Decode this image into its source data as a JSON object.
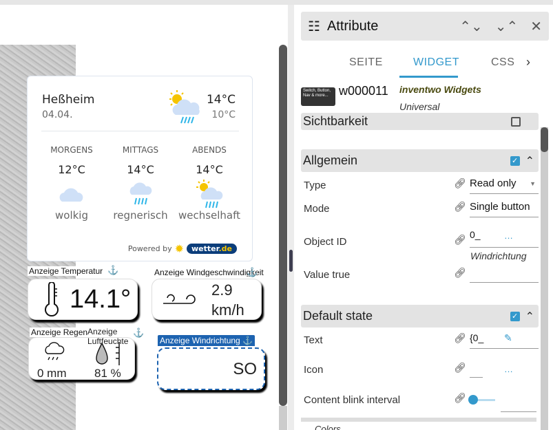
{
  "weather": {
    "city": "Heßheim",
    "date": "04.04.",
    "temp_max": "14°C",
    "temp_min": "10°C",
    "periods": [
      {
        "label": "MORGENS",
        "temp": "12°C",
        "desc": "wolkig",
        "icon": "cloud-icon"
      },
      {
        "label": "MITTAGS",
        "temp": "14°C",
        "desc": "regnerisch",
        "icon": "rain-cloud-icon"
      },
      {
        "label": "ABENDS",
        "temp": "14°C",
        "desc": "wechselhaft",
        "icon": "sun-rain-cloud-icon"
      }
    ],
    "powered_by": "Powered by",
    "logo": "wetter.de"
  },
  "widgets": {
    "temperature": {
      "label": "Anzeige Temperatur",
      "value": "14.1°"
    },
    "wind_speed": {
      "label": "Anzeige Windgeschwindigkeit",
      "value": "2.9",
      "unit": "km/h"
    },
    "rain": {
      "label": "Anzeige Regen",
      "value": "0 mm"
    },
    "humidity": {
      "label": "Anzeige Luftfeuchte",
      "value": "81 %"
    },
    "wind_direction": {
      "label": "Anzeige Windrichtung",
      "value": "SO"
    }
  },
  "panel": {
    "title": "Attribute",
    "tabs": [
      "SEITE",
      "WIDGET",
      "CSS"
    ],
    "active_tab": "WIDGET",
    "widget_id": "w000011",
    "widget_set": "inventwo Widgets",
    "widget_type": "Universal",
    "thumb_text": "Switch, Button, Nav & more...",
    "sections": {
      "visibility": "Sichtbarkeit",
      "general": "Allgemein",
      "default_state": "Default state",
      "colors": "Colors"
    },
    "general": [
      {
        "label": "Type",
        "value": "Read only"
      },
      {
        "label": "Mode",
        "value": "Single button"
      },
      {
        "label": "Object ID",
        "value": "0_",
        "hint": "Windrichtung"
      },
      {
        "label": "Value true",
        "value": ""
      }
    ],
    "default_state": [
      {
        "label": "Text",
        "value": "{0_"
      },
      {
        "label": "Icon",
        "value": ""
      },
      {
        "label": "Content blink interval",
        "value": "",
        "slider": 0
      }
    ],
    "accent": "#3399cc"
  }
}
